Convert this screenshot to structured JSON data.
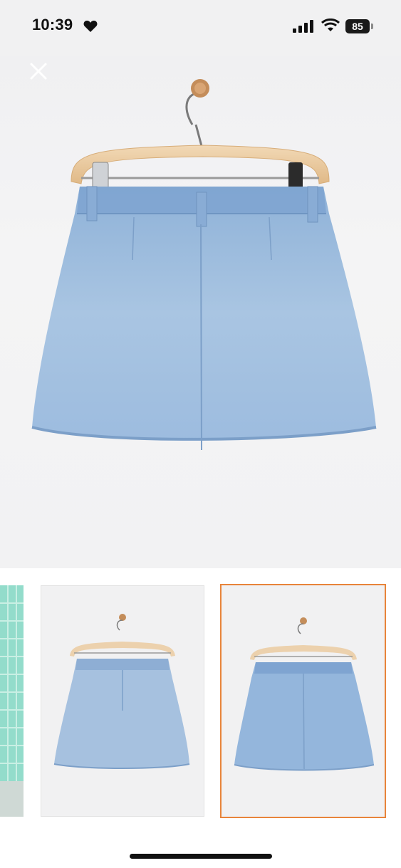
{
  "status_bar": {
    "time": "10:39",
    "battery": "85"
  },
  "icons": {
    "heart": "heart-icon",
    "signal": "cellular-signal-icon",
    "wifi": "wifi-icon",
    "close": "close-icon"
  },
  "gallery": {
    "selected_index": 2,
    "accent_color": "#e8843a"
  }
}
